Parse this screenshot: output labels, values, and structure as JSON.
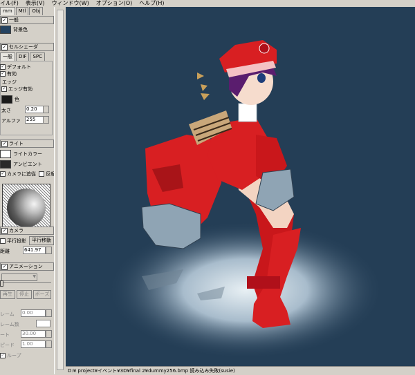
{
  "menubar": [
    "イル(F)",
    "表示(V)",
    "ウィンドウ(W)",
    "オプション(O)",
    "ヘルプ(H)"
  ],
  "tabs": [
    "mm",
    "Mtl",
    "Obj"
  ],
  "general": {
    "section": "一般",
    "bg_color_label": "背景色",
    "bg_color": "#244260"
  },
  "cel": {
    "section": "セルシェーダ",
    "tabs": [
      "一般",
      "DIF",
      "SPC"
    ],
    "default_label": "デフォルト",
    "enabled_label": "有効",
    "edge_group": "エッジ",
    "edge_enabled_label": "エッジ有効",
    "color_label": "色",
    "thickness_label": "太さ",
    "thickness_value": "0.20",
    "alpha_label": "アルファ",
    "alpha_value": "255"
  },
  "light": {
    "section": "ライト",
    "light_color_label": "ライトカラー",
    "ambient_label": "アンビエント",
    "follow_camera_label": "カメラに追従",
    "invert_label": "反転"
  },
  "camera": {
    "section": "カメラ",
    "parallel_projection_label": "平行投影",
    "parallel_move_label": "平行移動",
    "distance_label": "距離",
    "distance_value": "641.97"
  },
  "animation": {
    "section": "アニメーション",
    "play_label": "再生",
    "stop_label": "停止",
    "pause_label": "ポーズ",
    "frame_label": "レーム",
    "frame_value": "0.00",
    "frame_count_label": "レーム数",
    "rate_label": "ート",
    "rate_value": "30.00",
    "speed_label": "ピード",
    "speed_value": "1.00",
    "loop_label": "ループ"
  },
  "status_text": "D:¥ project¥イベント¥3D¥final 2¥dummy256.bmp 読み込み失敗(susie)",
  "colors": {
    "viewport_bg": "#243e56",
    "outfit_red": "#d81f22",
    "hair": "#5a1d6e"
  }
}
